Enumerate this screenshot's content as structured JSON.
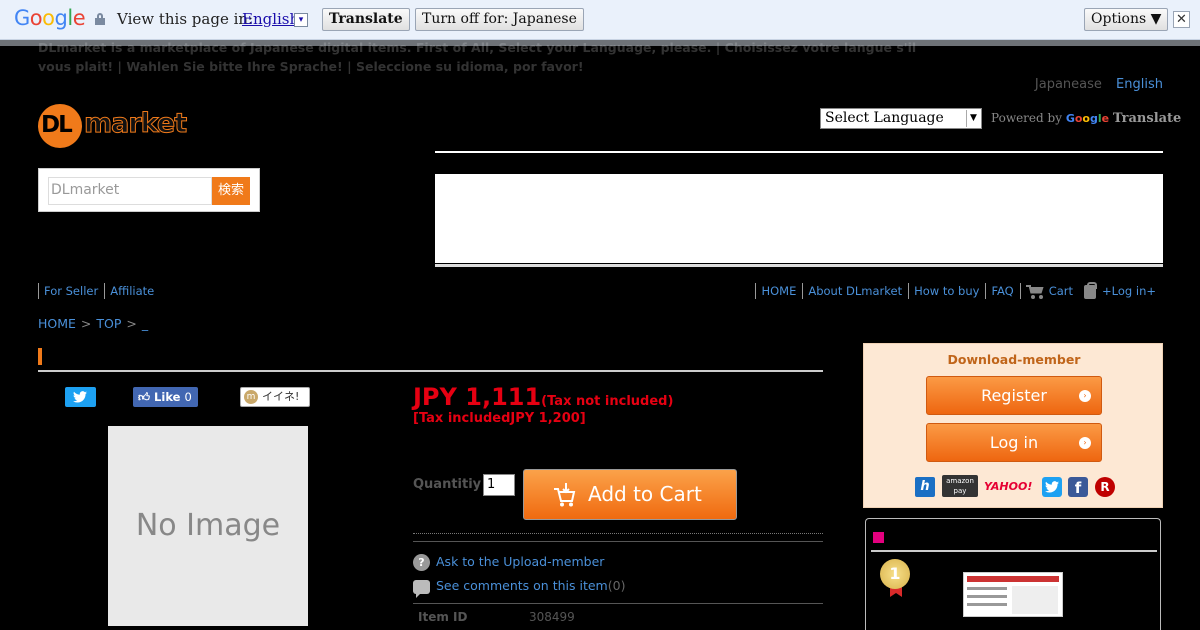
{
  "translate_bar": {
    "logo": [
      "G",
      "o",
      "o",
      "g",
      "l",
      "e"
    ],
    "view_text": "View this page in:",
    "language": "English",
    "translate_label": "Translate",
    "turn_off_label": "Turn off for: Japanese",
    "options_label": "Options ▼",
    "close_label": "✕"
  },
  "notice": "DLmarket is a marketplace of Japanese digital items. First of All, Select your Language, please. | Choisissez votre langue s'il vous plait! | Wahlen Sie bitte Ihre Sprache! | Seleccione su idioma, por favor!",
  "languages": {
    "japanese": "Japanease",
    "english": "English"
  },
  "logo": {
    "dl": "DL",
    "market": "market"
  },
  "select_language": {
    "value": "Select Language"
  },
  "powered": {
    "prefix": "Powered by",
    "google": "Google",
    "translate": "Translate"
  },
  "search": {
    "placeholder": "DLmarket",
    "button": "検索"
  },
  "nav_left": [
    "For Seller",
    "Affiliate"
  ],
  "nav_right": {
    "home": "HOME",
    "about": "About DLmarket",
    "howto": "How to buy",
    "faq": "FAQ",
    "cart": "Cart",
    "login": "+Log in+"
  },
  "breadcrumb": {
    "home": "HOME",
    "sep1": ">",
    "top": "TOP",
    "sep2": ">",
    "current": "_"
  },
  "social": {
    "like": "Like",
    "like_count": "0",
    "iine": "イイネ!",
    "iine_icon": "m"
  },
  "product": {
    "no_image": "No Image",
    "price": "JPY 1,111",
    "tax_note": "(Tax not included)",
    "tax_included": "[Tax includedJPY 1,200]",
    "quantity_label": "Quantitiy",
    "quantity_value": "1",
    "add_to_cart": "Add to Cart",
    "ask_icon": "?",
    "ask": "Ask to the Upload-member",
    "comments": "See comments on this item",
    "comments_count": "(0)",
    "item_id_label": "Item ID",
    "item_id": "308499"
  },
  "member": {
    "title": "Download-member",
    "register": "Register",
    "login": "Log in",
    "chevron": "›",
    "services": {
      "hatena": "h",
      "amazon": "amazon\npay",
      "yahoo": "YAHOO!",
      "facebook": "f",
      "rakuten": "R"
    }
  },
  "ranking": {
    "rank": "1"
  },
  "colors": {
    "accent": "#f07a1a",
    "price": "#e60012",
    "link": "#4a90d9"
  }
}
